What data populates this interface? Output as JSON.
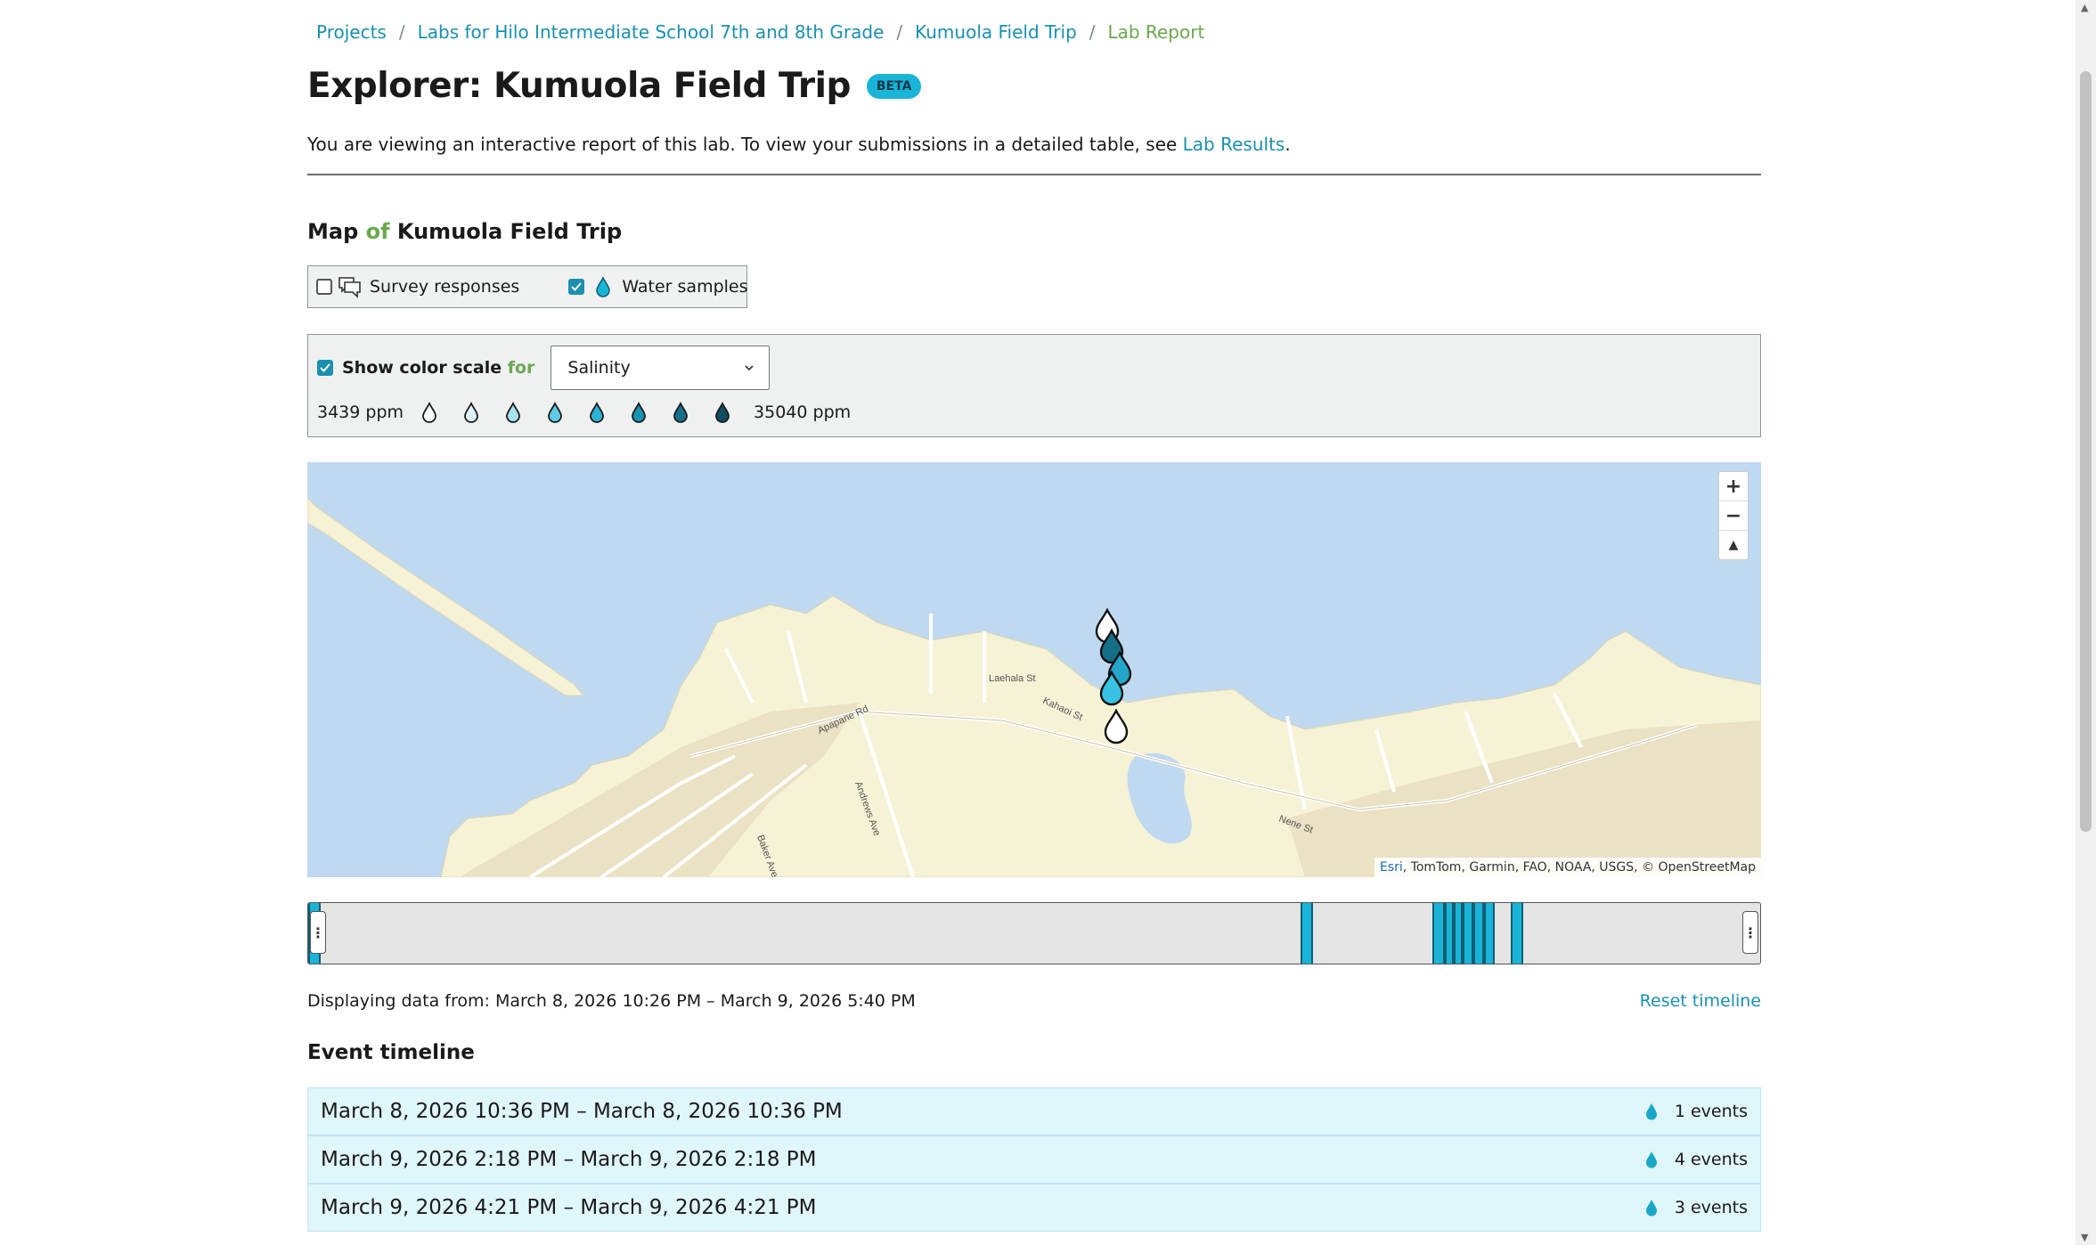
{
  "breadcrumb": {
    "items": [
      "Projects",
      "Labs for Hilo Intermediate School 7th and 8th Grade",
      "Kumuola Field Trip"
    ],
    "current": "Lab Report",
    "separator": "/"
  },
  "header": {
    "title": "Explorer: Kumuola Field Trip",
    "badge": "BETA",
    "intro_text": "You are viewing an interactive report of this lab. To view your submissions in a detailed table, see ",
    "intro_link": "Lab Results",
    "intro_end": "."
  },
  "map_section": {
    "title_pre": "Map ",
    "title_of": "of",
    "title_post": " Kumuola Field Trip",
    "layers": [
      {
        "label": "Survey responses",
        "checked": false,
        "icon": "chat-bubbles-icon"
      },
      {
        "label": "Water samples",
        "checked": true,
        "icon": "water-drop-icon"
      }
    ]
  },
  "color_scale": {
    "checkbox_checked": true,
    "label_pre": "Show color scale ",
    "label_for": "for",
    "selected": "Salinity",
    "min_label": "3439 ppm",
    "max_label": "35040 ppm",
    "drop_colors": [
      "#ffffff",
      "#dff4fa",
      "#a5e1f0",
      "#5fcbe6",
      "#2bb2d4",
      "#1893b2",
      "#14708a",
      "#0f4e61"
    ]
  },
  "map": {
    "zoom_in": "+",
    "zoom_out": "−",
    "compass": "▲",
    "attribution_esri": "Esri",
    "attribution_rest": ", TomTom, Garmin, FAO, NOAA, USGS, © OpenStreetMap",
    "street_labels": [
      "Laehala St",
      "Kahaoi St",
      "Apapane Rd",
      "Andrews Ave",
      "Baker Ave",
      "Nene St"
    ],
    "marker_colors": [
      "#ffffff",
      "#146f87",
      "#23a6c9",
      "#38c3e4",
      "#ffffff"
    ]
  },
  "timeline": {
    "handle_glyph": "⋮",
    "displaying_label": "Displaying data from: ",
    "range_text": "March 8, 2026 10:26 PM – March 9, 2026 5:40 PM",
    "reset_label": "Reset timeline"
  },
  "events": {
    "title": "Event timeline",
    "items": [
      {
        "range": "March 8, 2026 10:36 PM – March 8, 2026 10:36 PM",
        "count": "1 events"
      },
      {
        "range": "March 9, 2026 2:18 PM – March 9, 2026 2:18 PM",
        "count": "4 events"
      },
      {
        "range": "March 9, 2026 4:21 PM – March 9, 2026 4:21 PM",
        "count": "3 events"
      }
    ]
  },
  "colors": {
    "accent": "#1b8fb0",
    "current_crumb": "#6aa84f",
    "badge": "#1ab4d8",
    "event_bg": "#dff6fb"
  }
}
